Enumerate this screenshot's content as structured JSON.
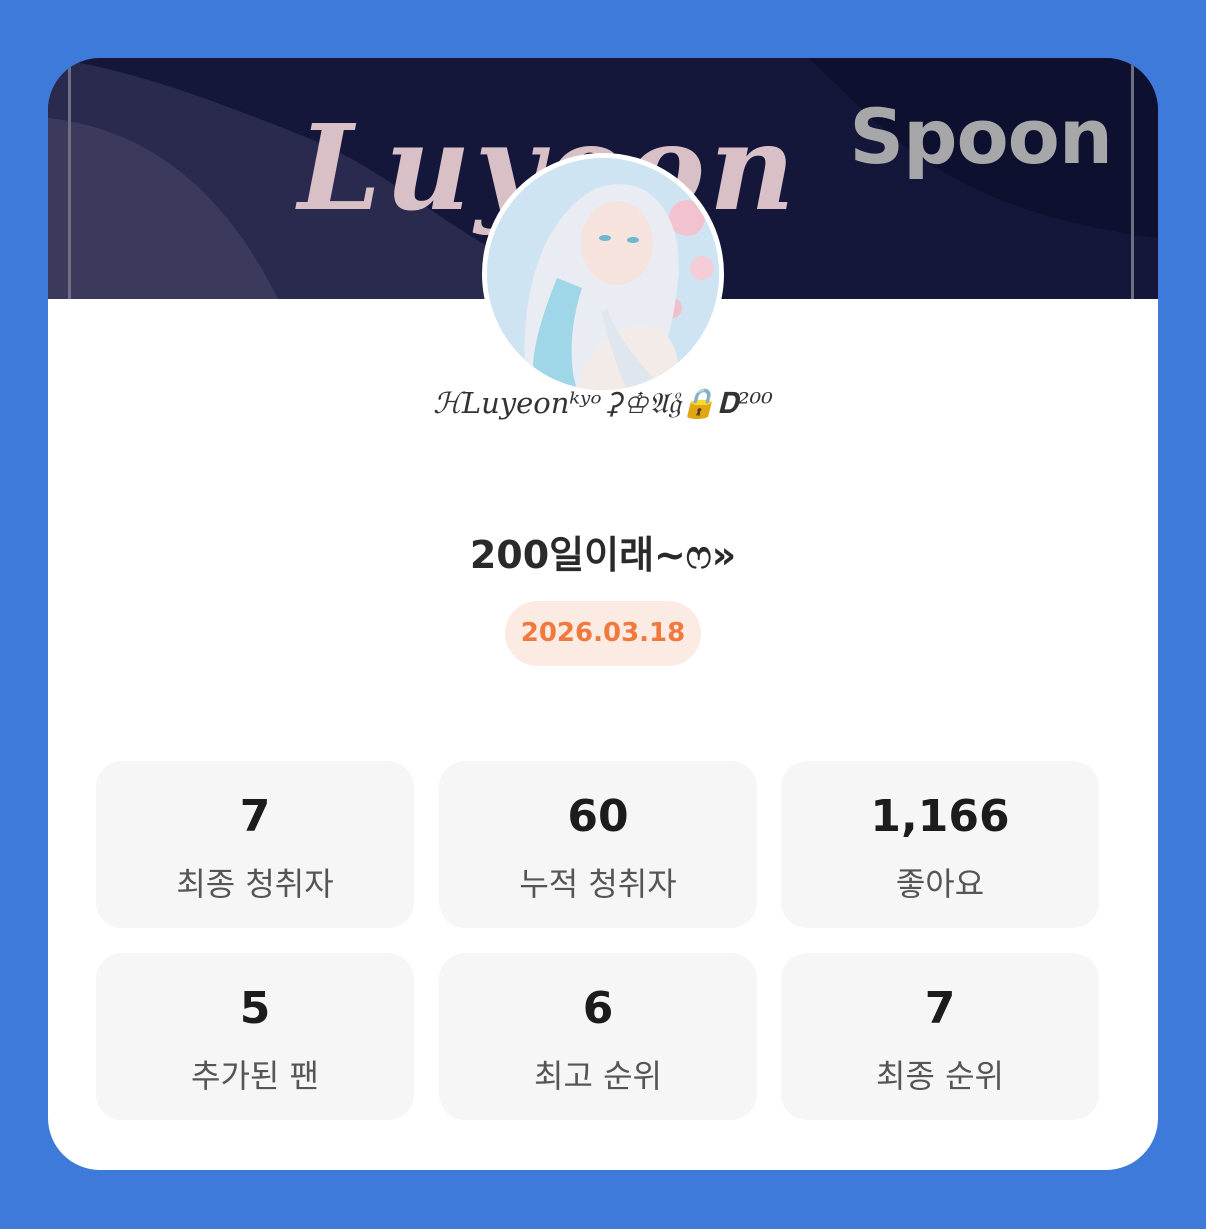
{
  "banner": {
    "text": "Luyeon",
    "brand": "Spoon"
  },
  "profile": {
    "nickname": "ℋLuyeonᵏʸᵒ⚳♔𝔄𝔤ͦ🔒𝐃²⁰⁰"
  },
  "live": {
    "title": "200일이래~ෆ»",
    "date": "2026.03.18"
  },
  "stats": [
    {
      "value": "7",
      "label": "최종 청취자"
    },
    {
      "value": "60",
      "label": "누적 청취자"
    },
    {
      "value": "1,166",
      "label": "좋아요"
    },
    {
      "value": "5",
      "label": "추가된 팬"
    },
    {
      "value": "6",
      "label": "최고 순위"
    },
    {
      "value": "7",
      "label": "최종 순위"
    }
  ],
  "colors": {
    "background": "#3e7ad9",
    "banner": "#161838",
    "date_badge_bg": "#fcebe3",
    "date_text": "#f07a3e",
    "stat_card_bg": "#f6f6f6"
  }
}
